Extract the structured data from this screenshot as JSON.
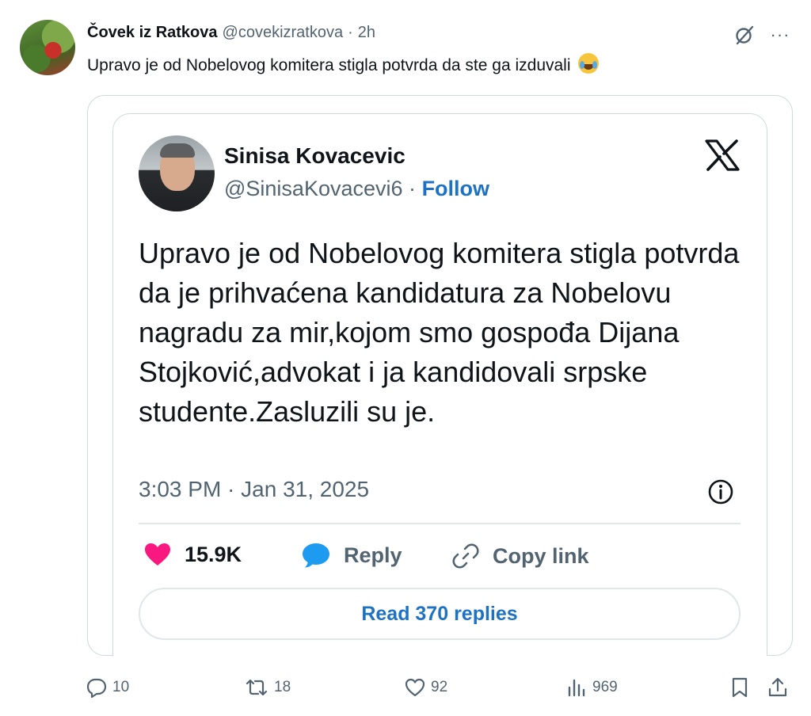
{
  "post": {
    "author_name": "Čovek iz Ratkova",
    "author_handle": "@covekizratkova",
    "separator": "·",
    "time": "2h",
    "more_label": "···",
    "text": "Upravo je od Nobelovog komitera stigla potvrda da ste ga izduvali",
    "emoji_icon": "face-with-tears-of-joy"
  },
  "embed": {
    "author_name": "Sinisa Kovacevic",
    "author_handle": "@SinisaKovacevi6",
    "separator": "·",
    "follow_label": "Follow",
    "body": "Upravo je od Nobelovog komitera stigla potvrda da je prihvaćena kandidatura za Nobelovu nagradu za mir,kojom smo gospođa Dijana Stojković,advokat i ja kandidovali srpske studente.Zasluzili su je.",
    "timestamp": "3:03 PM · Jan 31, 2025",
    "likes": "15.9K",
    "reply_label": "Reply",
    "copy_link_label": "Copy link",
    "read_replies_label": "Read 370 replies"
  },
  "stats": {
    "replies": "10",
    "reposts": "18",
    "likes": "92",
    "views": "969"
  },
  "colors": {
    "accent": "#1d72c4",
    "like_pink": "#f91880",
    "reply_blue": "#1d9bf0",
    "secondary_text": "#536471",
    "border": "#cfd9de"
  }
}
